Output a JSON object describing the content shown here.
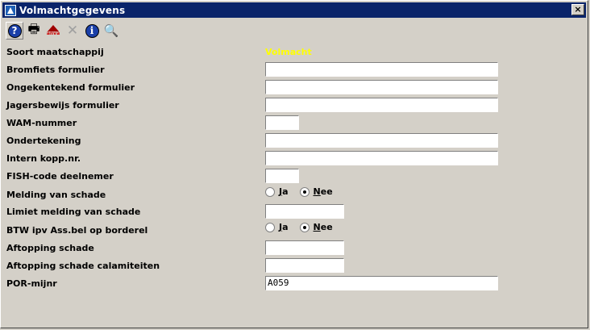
{
  "window": {
    "title": "Volmachtgegevens",
    "close_label": "×"
  },
  "toolbar": {
    "help_label": "?",
    "print_label": "🖶",
    "anva_label": "anva",
    "delete_label": "✕",
    "info_label": "i",
    "search_label": "🔍"
  },
  "form": {
    "soort": {
      "label": "Soort maatschappij",
      "value": "Volmacht"
    },
    "bromfiets": {
      "label": "Bromfiets formulier",
      "value": ""
    },
    "ongekentekend": {
      "label": "Ongekentekend formulier",
      "value": ""
    },
    "jagersbewijs": {
      "label": "Jagersbewijs formulier",
      "value": ""
    },
    "wam": {
      "label": "WAM-nummer",
      "value": ""
    },
    "ondertekening": {
      "label": "Ondertekening",
      "value": ""
    },
    "intern": {
      "label": "Intern kopp.nr.",
      "value": ""
    },
    "fish": {
      "label": "FISH-code deelnemer",
      "value": ""
    },
    "melding": {
      "label": "Melding van schade",
      "option_ja_first": "J",
      "option_ja_rest": "a",
      "option_nee_first": "N",
      "option_nee_rest": "ee",
      "selected": "Nee"
    },
    "limiet": {
      "label": "Limiet melding van schade",
      "value": ""
    },
    "btw": {
      "label": "BTW ipv Ass.bel op borderel",
      "option_ja_first": "J",
      "option_ja_rest": "a",
      "option_nee_first": "N",
      "option_nee_rest": "ee",
      "selected": "Nee"
    },
    "aftopping": {
      "label": "Aftopping schade",
      "value": ""
    },
    "aftopping_cal": {
      "label": "Aftopping schade calamiteiten",
      "value": ""
    },
    "por": {
      "label": "POR-mijnr",
      "value": "A059"
    }
  },
  "colors": {
    "titlebar": "#0a246a",
    "background": "#d4d0c8",
    "highlight_value": "#ffff00"
  }
}
